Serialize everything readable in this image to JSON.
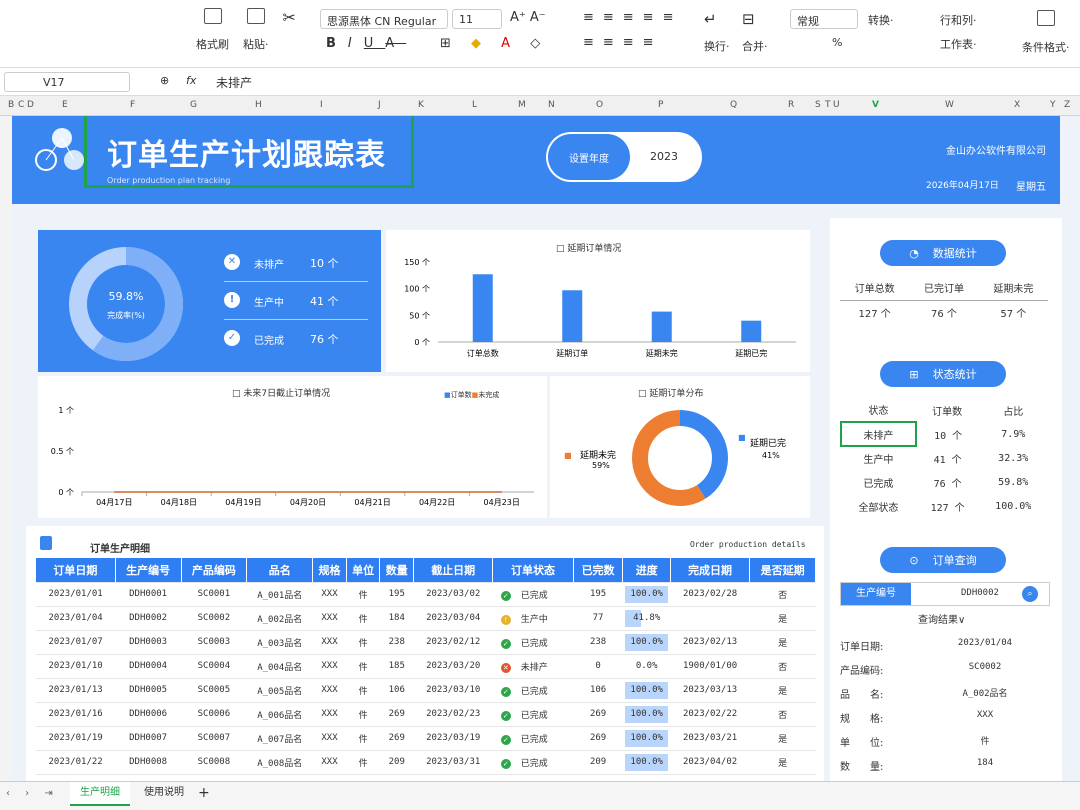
{
  "ribbon": {
    "buttons": [
      {
        "icon": "format-painter-icon",
        "label": "格式刷"
      },
      {
        "icon": "paste-icon",
        "label": "粘贴·"
      },
      {
        "icon": "cut-icon",
        "label": ""
      }
    ],
    "font_name": "思源黑体 CN Regular",
    "font_size": "11",
    "wrap_label": "换行·",
    "merge_label": "合并·",
    "number_format": "常规",
    "convert_label": "转换·",
    "rowcol_label": "行和列·",
    "worksheet_label": "工作表·",
    "cond_format_label": "条件格式·",
    "percent": "%"
  },
  "formula_bar": {
    "cell_ref": "V17",
    "fx": "fx",
    "value": "未排产"
  },
  "columns": [
    "B",
    "C",
    "D",
    "E",
    "F",
    "G",
    "H",
    "I",
    "J",
    "K",
    "L",
    "M",
    "N",
    "O",
    "P",
    "Q",
    "R",
    "S",
    "T",
    "U",
    "V",
    "W",
    "X",
    "Y",
    "Z"
  ],
  "banner": {
    "title": "订单生产计划跟踪表",
    "subtitle": "Order production plan tracking",
    "year_label": "设置年度",
    "year": "2023",
    "company": "金山办公软件有限公司",
    "date": "2026年04月17日",
    "weekday": "星期五"
  },
  "summary": {
    "rate": "59.8%",
    "rate_label": "完成率(%)",
    "items": [
      {
        "icon": "x-circle-icon",
        "label": "未排产",
        "value": "10 个"
      },
      {
        "icon": "exclaim-circle-icon",
        "label": "生产中",
        "value": "41 个"
      },
      {
        "icon": "check-circle-icon",
        "label": "已完成",
        "value": "76 个"
      }
    ]
  },
  "chart_data": [
    {
      "type": "bar",
      "title": "延期订单情况",
      "categories": [
        "订单总数",
        "延期订单",
        "延期未完",
        "延期已完"
      ],
      "values": [
        127,
        97,
        57,
        40
      ],
      "ylim": [
        0,
        150
      ],
      "yticks": [
        "150 个",
        "100 个",
        "50 个",
        "0 个"
      ],
      "color": "#3a86f0"
    },
    {
      "type": "line",
      "title": "未来7日截止订单情况",
      "x": [
        "04月17日",
        "04月18日",
        "04月19日",
        "04月20日",
        "04月21日",
        "04月22日",
        "04月23日"
      ],
      "series": [
        {
          "name": "订单数",
          "values": [
            0,
            0,
            0,
            0,
            0,
            0,
            0
          ],
          "color": "#3a86f0"
        },
        {
          "name": "未完成",
          "values": [
            0,
            0,
            0,
            0,
            0,
            0,
            0
          ],
          "color": "#ed7d31"
        }
      ],
      "ylim": [
        0,
        1
      ],
      "yticks": [
        "1 个",
        "0.5 个",
        "0 个"
      ]
    },
    {
      "type": "pie",
      "title": "延期订单分布",
      "slices": [
        {
          "name": "延期已完",
          "value": 41,
          "label": "41%",
          "color": "#3a86f0"
        },
        {
          "name": "延期未完",
          "value": 59,
          "label": "59%",
          "color": "#ed7d31"
        }
      ]
    }
  ],
  "detail": {
    "title": "订单生产明细",
    "en": "Order production details",
    "headers": [
      "订单日期",
      "生产编号",
      "产品编码",
      "品名",
      "规格",
      "单位",
      "数量",
      "截止日期",
      "订单状态",
      "已完数",
      "进度",
      "完成日期",
      "是否延期"
    ],
    "rows": [
      {
        "date": "2023/01/01",
        "no": "DDH0001",
        "code": "SC0001",
        "name": "A_001品名",
        "spec": "XXX",
        "unit": "件",
        "qty": "195",
        "due": "2023/03/02",
        "status": "已完成",
        "st": "done",
        "doneq": "195",
        "prog": "100.0%",
        "p": 1.0,
        "fin": "2023/02/28",
        "late": "否"
      },
      {
        "date": "2023/01/04",
        "no": "DDH0002",
        "code": "SC0002",
        "name": "A_002品名",
        "spec": "XXX",
        "unit": "件",
        "qty": "184",
        "due": "2023/03/04",
        "status": "生产中",
        "st": "prod",
        "doneq": "77",
        "prog": "41.8%",
        "p": 0.418,
        "fin": "",
        "late": "是"
      },
      {
        "date": "2023/01/07",
        "no": "DDH0003",
        "code": "SC0003",
        "name": "A_003品名",
        "spec": "XXX",
        "unit": "件",
        "qty": "238",
        "due": "2023/02/12",
        "status": "已完成",
        "st": "done",
        "doneq": "238",
        "prog": "100.0%",
        "p": 1.0,
        "fin": "2023/02/13",
        "late": "是"
      },
      {
        "date": "2023/01/10",
        "no": "DDH0004",
        "code": "SC0004",
        "name": "A_004品名",
        "spec": "XXX",
        "unit": "件",
        "qty": "185",
        "due": "2023/03/20",
        "status": "未排产",
        "st": "none",
        "doneq": "0",
        "prog": "0.0%",
        "p": 0,
        "fin": "1900/01/00",
        "late": "否"
      },
      {
        "date": "2023/01/13",
        "no": "DDH0005",
        "code": "SC0005",
        "name": "A_005品名",
        "spec": "XXX",
        "unit": "件",
        "qty": "106",
        "due": "2023/03/10",
        "status": "已完成",
        "st": "done",
        "doneq": "106",
        "prog": "100.0%",
        "p": 1.0,
        "fin": "2023/03/13",
        "late": "是"
      },
      {
        "date": "2023/01/16",
        "no": "DDH0006",
        "code": "SC0006",
        "name": "A_006品名",
        "spec": "XXX",
        "unit": "件",
        "qty": "269",
        "due": "2023/02/23",
        "status": "已完成",
        "st": "done",
        "doneq": "269",
        "prog": "100.0%",
        "p": 1.0,
        "fin": "2023/02/22",
        "late": "否"
      },
      {
        "date": "2023/01/19",
        "no": "DDH0007",
        "code": "SC0007",
        "name": "A_007品名",
        "spec": "XXX",
        "unit": "件",
        "qty": "269",
        "due": "2023/03/19",
        "status": "已完成",
        "st": "done",
        "doneq": "269",
        "prog": "100.0%",
        "p": 1.0,
        "fin": "2023/03/21",
        "late": "是"
      },
      {
        "date": "2023/01/22",
        "no": "DDH0008",
        "code": "SC0008",
        "name": "A_008品名",
        "spec": "XXX",
        "unit": "件",
        "qty": "209",
        "due": "2023/03/31",
        "status": "已完成",
        "st": "done",
        "doneq": "209",
        "prog": "100.0%",
        "p": 1.0,
        "fin": "2023/04/02",
        "late": "是"
      }
    ]
  },
  "stats": {
    "title": "数据统计",
    "headers": [
      "订单总数",
      "已完订单",
      "延期未完"
    ],
    "values": [
      "127 个",
      "76 个",
      "57 个"
    ]
  },
  "status": {
    "title": "状态统计",
    "headers": [
      "状态",
      "订单数",
      "占比"
    ],
    "rows": [
      [
        "未排产",
        "10 个",
        "7.9%"
      ],
      [
        "生产中",
        "41 个",
        "32.3%"
      ],
      [
        "已完成",
        "76 个",
        "59.8%"
      ],
      [
        "全部状态",
        "127 个",
        "100.0%"
      ]
    ]
  },
  "query": {
    "title": "订单查询",
    "key_label": "生产编号",
    "key_value": "DDH0002",
    "result_label": "查询结果∨",
    "fields": [
      [
        "订单日期:",
        "2023/01/04"
      ],
      [
        "产品编码:",
        "SC0002"
      ],
      [
        "品　　名:",
        "A_002品名"
      ],
      [
        "规　　格:",
        "XXX"
      ],
      [
        "单　　位:",
        "件"
      ],
      [
        "数　　量:",
        "184"
      ]
    ]
  },
  "tabs": [
    "生产明细",
    "使用说明"
  ]
}
